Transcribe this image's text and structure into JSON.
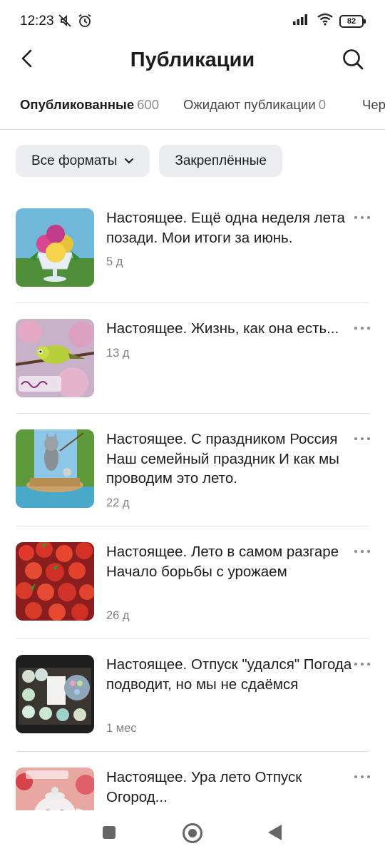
{
  "status_bar": {
    "time": "12:23",
    "left_icons": [
      "mute-icon",
      "alarm-icon"
    ],
    "right_icons": [
      "signal-icon",
      "wifi-icon"
    ],
    "battery_level": "82"
  },
  "header": {
    "title": "Публикации",
    "back_icon": "chevron-left-icon",
    "search_icon": "search-icon"
  },
  "tabs": [
    {
      "label": "Опубликованные",
      "count": "600",
      "active": true
    },
    {
      "label": "Ожидают публикации",
      "count": "0",
      "active": false
    },
    {
      "label": "Чер",
      "count": "",
      "active": false
    }
  ],
  "filters": {
    "format_label": "Все форматы",
    "pinned_label": "Закреплённые"
  },
  "posts": [
    {
      "title": "Настоящее. Ещё одна неделя лета позади. Мои итоги за июнь.",
      "time": "5 д",
      "thumb": "ice-cream"
    },
    {
      "title": "Настоящее. Жизнь, как она есть...",
      "time": "13 д",
      "thumb": "bird-greeting"
    },
    {
      "title": "Настоящее. С праздником Россия Наш семейный праздник И как мы проводим это лето.",
      "time": "22 д",
      "thumb": "cat-fishing"
    },
    {
      "title": "Настоящее. Лето в самом разгаре Начало борьбы с урожаем",
      "time": "26 д",
      "thumb": "strawberries"
    },
    {
      "title": "Настоящее. Отпуск \"удался\" Погода подводит, но мы не сдаёмся",
      "time": "1 мес",
      "thumb": "jars"
    },
    {
      "title": "Настоящее. Ура лето Отпуск Огород...",
      "time": "",
      "thumb": "teapot"
    }
  ],
  "colors": {
    "text": "#1c1c1c",
    "muted": "#818181",
    "chip_bg": "#ebedf0",
    "divider": "#e3e3e3"
  }
}
